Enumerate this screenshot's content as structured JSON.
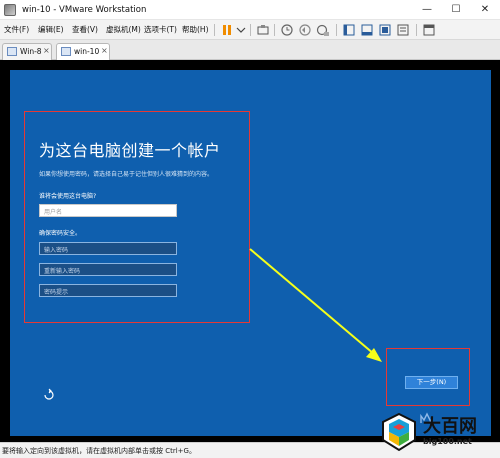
{
  "window": {
    "title": "win-10 - VMware Workstation",
    "minimize_glyph": "—",
    "maximize_glyph": "☐",
    "close_glyph": "✕"
  },
  "menu": {
    "items": [
      "文件(F)",
      "编辑(E)",
      "查看(V)",
      "虚拟机(M)",
      "选项卡(T)",
      "帮助(H)"
    ]
  },
  "toolbar": {
    "icons": [
      "pause-icon",
      "send-keys-icon",
      "snapshot-icon",
      "revert-snapshot-icon",
      "snapshot-manager-icon",
      "sidebar-icon",
      "thumbnail-icon",
      "fullscreen-icon",
      "unity-icon",
      "console-view-icon"
    ]
  },
  "tabs": [
    {
      "label": "Win-8",
      "active": false
    },
    {
      "label": "win-10",
      "active": true
    }
  ],
  "tab_close_glyph": "×",
  "setup": {
    "title": "为这台电脑创建一个帐户",
    "description": "如果你想使用密码，请选择自己易于记住但别人很难猜到的内容。",
    "user_question": "谁将会使用这台电脑?",
    "username_placeholder": "用户名",
    "password_section": "确保密码安全。",
    "password_placeholder": "输入密码",
    "reenter_placeholder": "重新输入密码",
    "hint_placeholder": "密码提示",
    "next_label": "下一步(N)"
  },
  "status": {
    "text": "要将输入定向到该虚拟机，请在虚拟机内部单击或按 Ctrl+G。"
  },
  "watermark": {
    "title": "大百网",
    "url": "big100.net"
  },
  "colors": {
    "vm_background": "#0f5fae",
    "highlight_border": "#e53935",
    "annotation_arrow": "#f5ff1a",
    "next_button": "#2f82d9"
  }
}
